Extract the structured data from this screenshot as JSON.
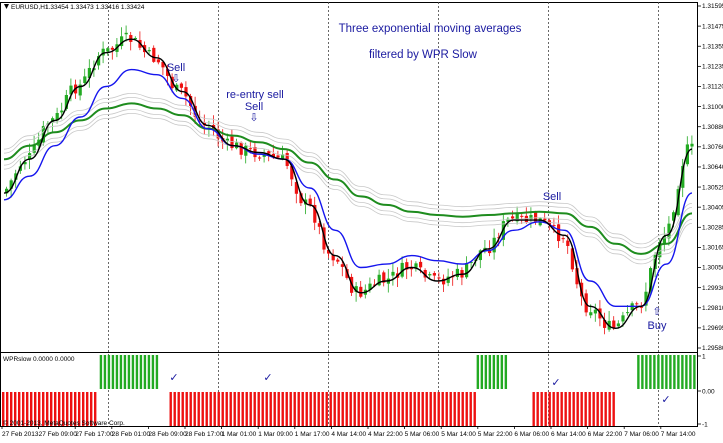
{
  "header": {
    "symbol_label": "EURUSD,H1",
    "ohlc": "1.33454 1.33473 1.33416 1.33424"
  },
  "annotations": {
    "title_line1": "Three exponential moving averages",
    "title_line2": "filtered by WPR Slow",
    "sell1": "Sell",
    "reentry_line1": "re-entry sell",
    "reentry_line2": "Sell",
    "sell3": "Sell",
    "buy": "Buy"
  },
  "indicator": {
    "label": "WPRslow 0.0000 0.0000",
    "copyright": "© 2001-2013, MetaQuotes Software Corp.",
    "ticks": [
      "1",
      "0.00",
      "-1"
    ]
  },
  "colors": {
    "bull": "#22aa22",
    "bear": "#ee1111",
    "ema_fast": "#000000",
    "ema_mid": "#1515ee",
    "ema_slow": "#1e8c1e",
    "envelope": "#c8c8c8",
    "annotation": "#1a1aa0"
  },
  "chart_data": {
    "type": "line",
    "symbol": "EURUSD",
    "timeframe": "H1",
    "y_ticks": [
      "1.31595",
      "1.31475",
      "1.31355",
      "1.31235",
      "1.31120",
      "1.31000",
      "1.30880",
      "1.30760",
      "1.30640",
      "1.30525",
      "1.30405",
      "1.30285",
      "1.30165",
      "1.30050",
      "1.29930",
      "1.29810",
      "1.29695",
      "1.29580"
    ],
    "ylim": [
      1.2958,
      1.3165
    ],
    "x_ticks": [
      "27 Feb 2013",
      "27 Feb 09:00",
      "27 Feb 17:00",
      "28 Feb 01:00",
      "28 Feb 09:00",
      "28 Feb 17:00",
      "1 Mar 01:00",
      "1 Mar 09:00",
      "1 Mar 17:00",
      "4 Mar 14:00",
      "4 Mar 22:00",
      "5 Mar 06:00",
      "5 Mar 14:00",
      "5 Mar 22:00",
      "6 Mar 06:00",
      "6 Mar 14:00",
      "6 Mar 22:00",
      "7 Mar 06:00",
      "7 Mar 14:00"
    ],
    "series": [
      {
        "name": "EMA fast",
        "values": [
          1.3052,
          1.3072,
          1.3095,
          1.3115,
          1.3135,
          1.3143,
          1.3132,
          1.3112,
          1.3092,
          1.308,
          1.3076,
          1.3072,
          1.3045,
          1.3015,
          1.2993,
          1.3,
          1.3008,
          1.3,
          1.3004,
          1.3019,
          1.3036,
          1.3036,
          1.3027,
          1.2985,
          1.2972,
          1.2985,
          1.3027,
          1.3078
        ]
      },
      {
        "name": "EMA mid",
        "values": [
          1.3048,
          1.3062,
          1.308,
          1.3097,
          1.3115,
          1.3125,
          1.3122,
          1.3108,
          1.309,
          1.308,
          1.3075,
          1.3072,
          1.3055,
          1.303,
          1.3008,
          1.301,
          1.3015,
          1.3012,
          1.301,
          1.3018,
          1.303,
          1.3035,
          1.303,
          1.3,
          1.2985,
          1.2985,
          1.301,
          1.3052
        ]
      },
      {
        "name": "EMA slow",
        "values": [
          1.3072,
          1.308,
          1.3088,
          1.3095,
          1.3102,
          1.3105,
          1.3102,
          1.3098,
          1.309,
          1.3086,
          1.3082,
          1.3078,
          1.307,
          1.306,
          1.305,
          1.3045,
          1.3041,
          1.3039,
          1.3038,
          1.3039,
          1.304,
          1.3041,
          1.304,
          1.3032,
          1.3022,
          1.3016,
          1.3022,
          1.304
        ]
      }
    ],
    "annotations": [
      {
        "text": "Sell",
        "time_index": 6
      },
      {
        "text": "re-entry sell Sell",
        "time_index": 10
      },
      {
        "text": "Sell",
        "time_index": 22
      },
      {
        "text": "Buy",
        "time_index": 26
      }
    ],
    "indicator_panel": {
      "name": "WPRslow",
      "ylim": [
        -1,
        1
      ],
      "y_ticks": [
        "1",
        "0.00",
        "-1"
      ],
      "bull_blocks": [
        [
          0.14,
          0.23
        ],
        [
          0.68,
          0.73
        ],
        [
          0.91,
          1.0
        ]
      ],
      "bear_blocks": [
        [
          0.0,
          0.14
        ],
        [
          0.24,
          0.68
        ],
        [
          0.76,
          0.88
        ]
      ],
      "gaps": [
        [
          0.23,
          0.24
        ],
        [
          0.73,
          0.76
        ],
        [
          0.88,
          0.91
        ]
      ]
    },
    "grid": false
  }
}
